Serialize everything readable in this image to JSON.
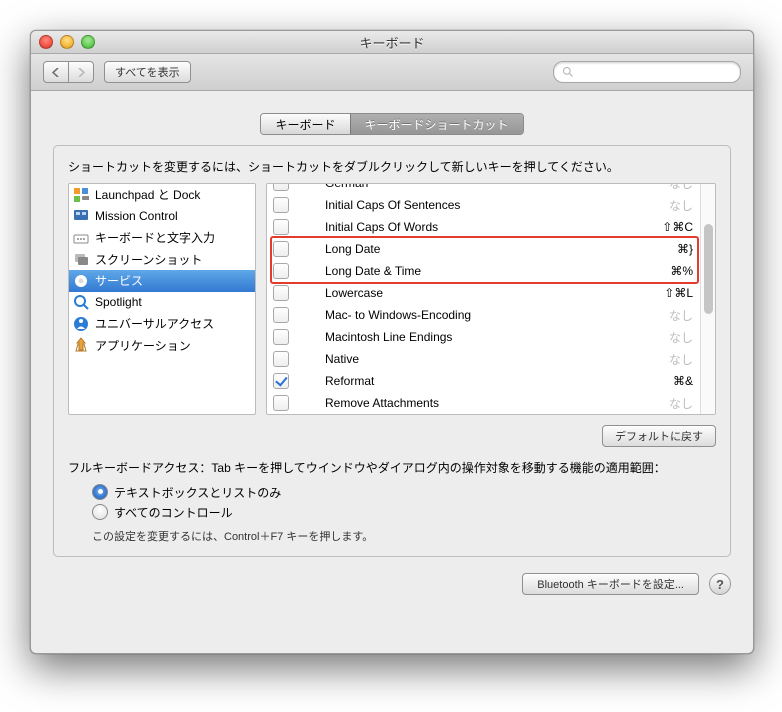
{
  "window": {
    "title": "キーボード"
  },
  "toolbar": {
    "showall": "すべてを表示"
  },
  "tabs": {
    "a": "キーボード",
    "b": "キーボードショートカット"
  },
  "instruction": "ショートカットを変更するには、ショートカットをダブルクリックして新しいキーを押してください。",
  "sidebar": [
    {
      "label": "Launchpad と Dock"
    },
    {
      "label": "Mission Control"
    },
    {
      "label": "キーボードと文字入力"
    },
    {
      "label": "スクリーンショット"
    },
    {
      "label": "サービス"
    },
    {
      "label": "Spotlight"
    },
    {
      "label": "ユニバーサルアクセス"
    },
    {
      "label": "アプリケーション"
    }
  ],
  "sidebar_selected": 4,
  "shortcuts": [
    {
      "checked": false,
      "label": "German",
      "sc": "なし",
      "none": true
    },
    {
      "checked": false,
      "label": "Initial Caps Of Sentences",
      "sc": "なし",
      "none": true
    },
    {
      "checked": false,
      "label": "Initial Caps Of Words",
      "sc": "⇧⌘C"
    },
    {
      "checked": false,
      "label": "Long Date",
      "sc": "⌘}",
      "hl": true
    },
    {
      "checked": false,
      "label": "Long Date & Time",
      "sc": "⌘%",
      "hl": true
    },
    {
      "checked": false,
      "label": "Lowercase",
      "sc": "⇧⌘L"
    },
    {
      "checked": false,
      "label": "Mac- to Windows-Encoding",
      "sc": "なし",
      "none": true
    },
    {
      "checked": false,
      "label": "Macintosh Line Endings",
      "sc": "なし",
      "none": true
    },
    {
      "checked": false,
      "label": "Native",
      "sc": "なし",
      "none": true
    },
    {
      "checked": true,
      "label": "Reformat",
      "sc": "⌘&"
    },
    {
      "checked": false,
      "label": "Remove Attachments",
      "sc": "なし",
      "none": true
    }
  ],
  "defaults_btn": "デフォルトに戻す",
  "fka": {
    "label": "フルキーボードアクセス：Tab キーを押してウインドウやダイアログ内の操作対象を移動する機能の適用範囲：",
    "opt1": "テキストボックスとリストのみ",
    "opt2": "すべてのコントロール",
    "hint": "この設定を変更するには、Control＋F7 キーを押します。"
  },
  "footer": {
    "bt": "Bluetooth キーボードを設定..."
  }
}
